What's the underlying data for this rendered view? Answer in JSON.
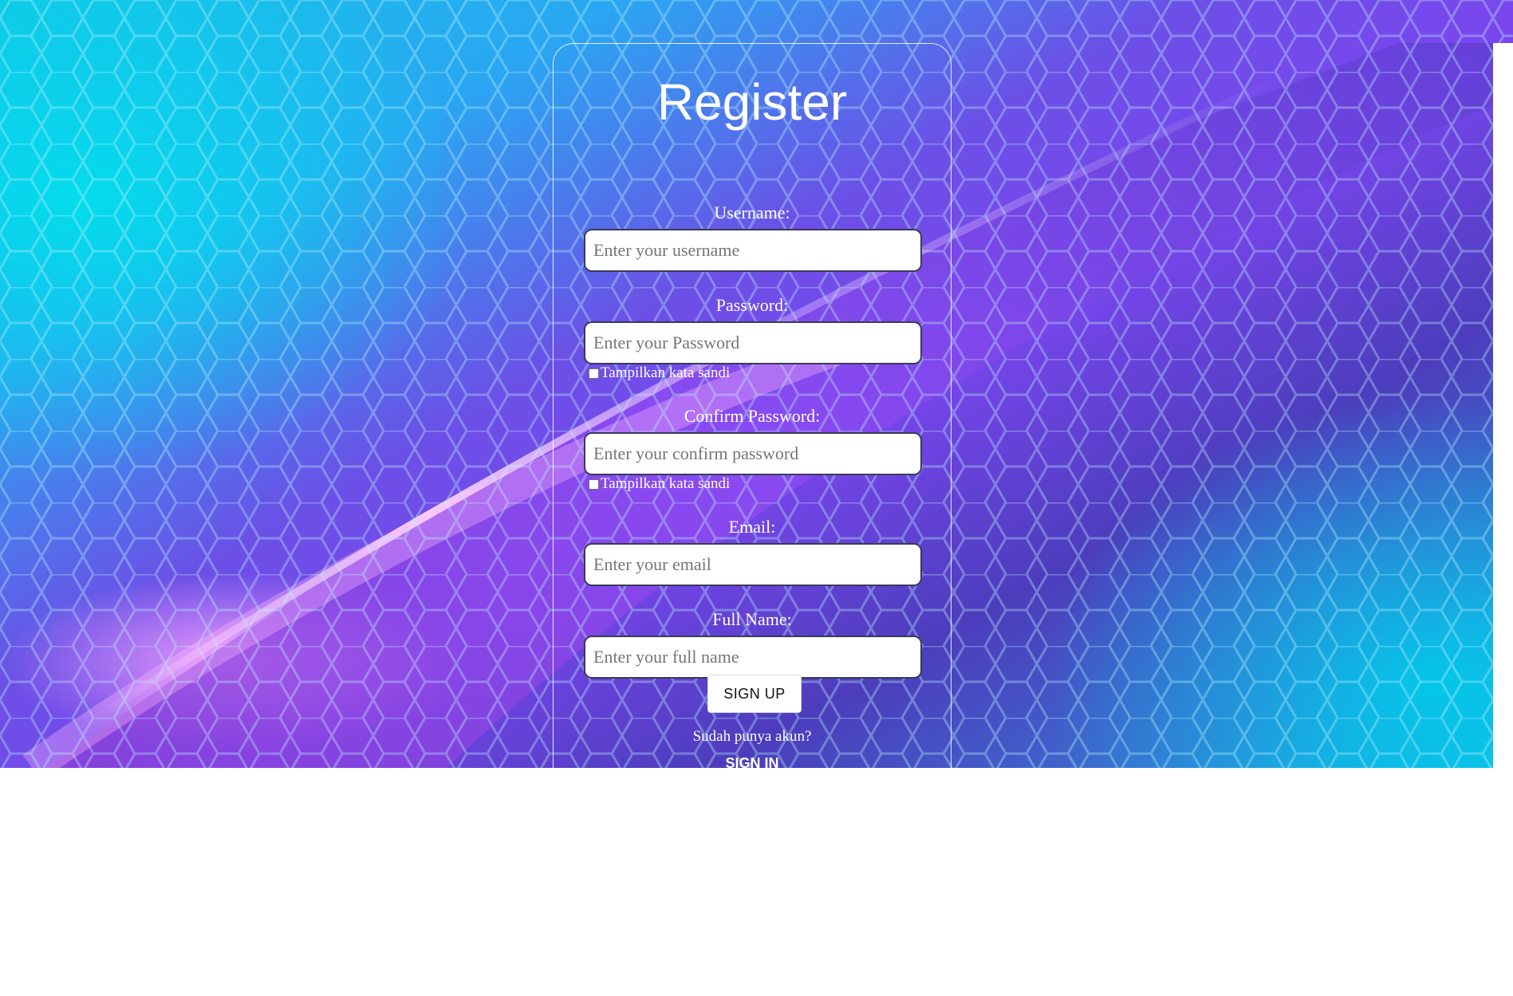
{
  "page": {
    "title": "Register",
    "colors": {
      "background_start": "#12c6e6",
      "background_mid": "#7a46ee",
      "background_end": "#18b6e6",
      "card_border": "#ffffff",
      "text": "#ffffff"
    }
  },
  "form": {
    "username": {
      "label": "Username:",
      "placeholder": "Enter your username",
      "value": ""
    },
    "password": {
      "label": "Password:",
      "placeholder": "Enter your Password",
      "value": "",
      "show_toggle": {
        "label": "Tampilkan kata sandi",
        "checked": false
      }
    },
    "confirm_password": {
      "label": "Confirm Password:",
      "placeholder": "Enter your confirm password",
      "value": "",
      "show_toggle": {
        "label": "Tampilkan kata sandi",
        "checked": false
      }
    },
    "email": {
      "label": "Email:",
      "placeholder": "Enter your email",
      "value": ""
    },
    "full_name": {
      "label": "Full Name:",
      "placeholder": "Enter your full name",
      "value": ""
    },
    "submit_label": "SIGN UP"
  },
  "footer": {
    "prompt": "Sudah punya akun?",
    "signin_label": "SIGN IN"
  }
}
